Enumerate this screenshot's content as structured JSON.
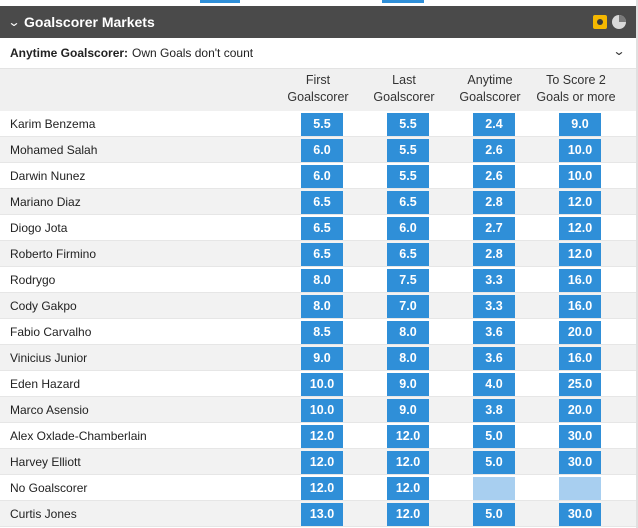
{
  "market": {
    "title": "Goalscorer Markets",
    "subtitle_label": "Anytime Goalscorer:",
    "subtitle_text": "Own Goals don't count"
  },
  "icons": [
    "chevron-down-icon",
    "tv-icon",
    "stats-icon",
    "expand-chevron-icon"
  ],
  "colors": {
    "header_bg": "#4a4a4a",
    "odds_blue": "#2f8fd8",
    "odds_disabled": "#a8cff0",
    "tv_icon": "#f5b800"
  },
  "columns": [
    [
      "First",
      "Goalscorer"
    ],
    [
      "Last",
      "Goalscorer"
    ],
    [
      "Anytime",
      "Goalscorer"
    ],
    [
      "To Score 2",
      "Goals or more"
    ]
  ],
  "rows": [
    {
      "name": "Karim Benzema",
      "odds": [
        "5.5",
        "5.5",
        "2.4",
        "9.0"
      ]
    },
    {
      "name": "Mohamed Salah",
      "odds": [
        "6.0",
        "5.5",
        "2.6",
        "10.0"
      ]
    },
    {
      "name": "Darwin Nunez",
      "odds": [
        "6.0",
        "5.5",
        "2.6",
        "10.0"
      ]
    },
    {
      "name": "Mariano Diaz",
      "odds": [
        "6.5",
        "6.5",
        "2.8",
        "12.0"
      ]
    },
    {
      "name": "Diogo Jota",
      "odds": [
        "6.5",
        "6.0",
        "2.7",
        "12.0"
      ]
    },
    {
      "name": "Roberto Firmino",
      "odds": [
        "6.5",
        "6.5",
        "2.8",
        "12.0"
      ]
    },
    {
      "name": "Rodrygo",
      "odds": [
        "8.0",
        "7.5",
        "3.3",
        "16.0"
      ]
    },
    {
      "name": "Cody Gakpo",
      "odds": [
        "8.0",
        "7.0",
        "3.3",
        "16.0"
      ]
    },
    {
      "name": "Fabio Carvalho",
      "odds": [
        "8.5",
        "8.0",
        "3.6",
        "20.0"
      ]
    },
    {
      "name": "Vinicius Junior",
      "odds": [
        "9.0",
        "8.0",
        "3.6",
        "16.0"
      ]
    },
    {
      "name": "Eden Hazard",
      "odds": [
        "10.0",
        "9.0",
        "4.0",
        "25.0"
      ]
    },
    {
      "name": "Marco Asensio",
      "odds": [
        "10.0",
        "9.0",
        "3.8",
        "20.0"
      ]
    },
    {
      "name": "Alex Oxlade-Chamberlain",
      "odds": [
        "12.0",
        "12.0",
        "5.0",
        "30.0"
      ]
    },
    {
      "name": "Harvey Elliott",
      "odds": [
        "12.0",
        "12.0",
        "5.0",
        "30.0"
      ]
    },
    {
      "name": "No Goalscorer",
      "odds": [
        "12.0",
        "12.0",
        "",
        ""
      ]
    },
    {
      "name": "Curtis Jones",
      "odds": [
        "13.0",
        "12.0",
        "5.0",
        "30.0"
      ]
    }
  ]
}
